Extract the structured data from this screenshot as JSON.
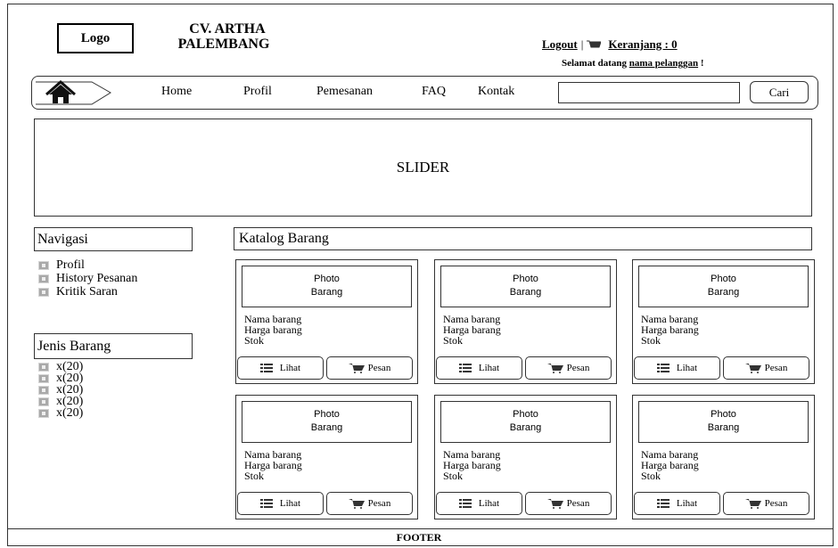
{
  "header": {
    "logo_label": "Logo",
    "brand_line1": "CV. ARTHA",
    "brand_line2": "PALEMBANG",
    "logout_label": "Logout",
    "separator": "|",
    "cart_label": "Keranjang : 0",
    "welcome_prefix": "Selamat datang",
    "welcome_name": "nama pelanggan",
    "welcome_suffix": "!"
  },
  "nav": {
    "items": [
      "Home",
      "Profil",
      "Pemesanan",
      "FAQ",
      "Kontak"
    ],
    "search_value": "",
    "search_button": "Cari"
  },
  "slider": {
    "label": "SLIDER"
  },
  "sidebar": {
    "nav_title": "Navigasi",
    "nav_items": [
      "Profil",
      "History Pesanan",
      "Kritik Saran"
    ],
    "category_title": "Jenis Barang",
    "category_items": [
      "x(20)",
      "x(20)",
      "x(20)",
      "x(20)",
      "x(20)"
    ]
  },
  "catalog": {
    "title": "Katalog Barang",
    "products": [
      {
        "photo_line1": "Photo",
        "photo_line2": "Barang",
        "name": "Nama barang",
        "price": "Harga barang",
        "stock": "Stok",
        "view_label": "Lihat",
        "order_label": "Pesan"
      },
      {
        "photo_line1": "Photo",
        "photo_line2": "Barang",
        "name": "Nama barang",
        "price": "Harga barang",
        "stock": "Stok",
        "view_label": "Lihat",
        "order_label": "Pesan"
      },
      {
        "photo_line1": "Photo",
        "photo_line2": "Barang",
        "name": "Nama barang",
        "price": "Harga barang",
        "stock": "Stok",
        "view_label": "Lihat",
        "order_label": "Pesan"
      },
      {
        "photo_line1": "Photo",
        "photo_line2": "Barang",
        "name": "Nama barang",
        "price": "Harga barang",
        "stock": "Stok",
        "view_label": "Lihat",
        "order_label": "Pesan"
      },
      {
        "photo_line1": "Photo",
        "photo_line2": "Barang",
        "name": "Nama barang",
        "price": "Harga barang",
        "stock": "Stok",
        "view_label": "Lihat",
        "order_label": "Pesan"
      },
      {
        "photo_line1": "Photo",
        "photo_line2": "Barang",
        "name": "Nama barang",
        "price": "Harga barang",
        "stock": "Stok",
        "view_label": "Lihat",
        "order_label": "Pesan"
      }
    ]
  },
  "footer": {
    "label": "FOOTER"
  },
  "icons": {
    "home": "home-icon",
    "cart": "cart-icon",
    "list": "list-icon",
    "bullet": "bullet-icon"
  }
}
